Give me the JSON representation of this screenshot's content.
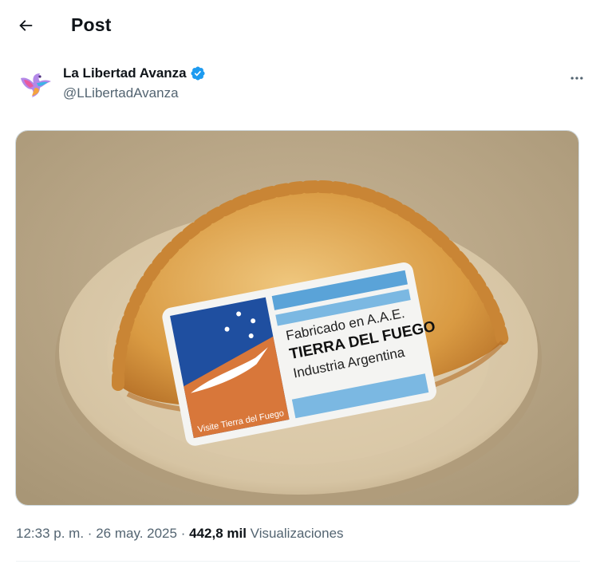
{
  "header": {
    "title": "Post",
    "back_icon": "arrow-left-icon"
  },
  "author": {
    "display_name": "La Libertad Avanza",
    "handle": "@LLibertadAvanza",
    "verified": true,
    "verified_color": "#1d9bf0",
    "avatar_icon": "eagle-logo-icon"
  },
  "more_icon": "more-horizontal-icon",
  "image": {
    "label_line1": "Fabricado en A.A.E.",
    "label_line2": "TIERRA DEL FUEGO",
    "label_line3": "Industria Argentina",
    "sticker_caption": "Visite Tierra del Fuego"
  },
  "meta": {
    "time": "12:33 p. m.",
    "separator": "·",
    "date": "26 may. 2025",
    "views_count": "442,8 mil",
    "views_label": "Visualizaciones"
  },
  "colors": {
    "text": "#0f1419",
    "secondary": "#536471",
    "accent": "#1d9bf0"
  }
}
